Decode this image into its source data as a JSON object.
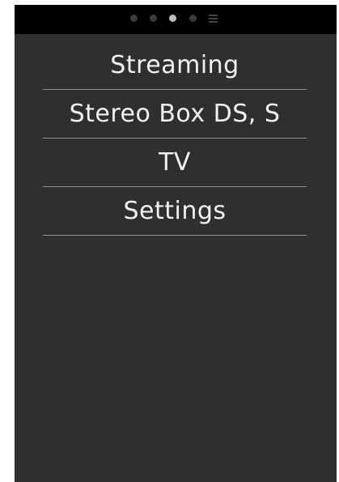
{
  "pager": {
    "active_index": 2,
    "icons": [
      "page-dot",
      "page-dot",
      "page-dot",
      "page-dot",
      "menu-icon"
    ]
  },
  "menu": {
    "items": [
      {
        "label": "Streaming"
      },
      {
        "label": "Stereo Box DS, S"
      },
      {
        "label": "TV"
      },
      {
        "label": "Settings"
      }
    ]
  },
  "colors": {
    "background": "#2f2f2f",
    "topbar": "#000000",
    "text": "#f2f2f2",
    "divider": "#8e8e8e",
    "dot_active": "#bdbdbd",
    "dot_inactive": "#3a3a3a"
  }
}
